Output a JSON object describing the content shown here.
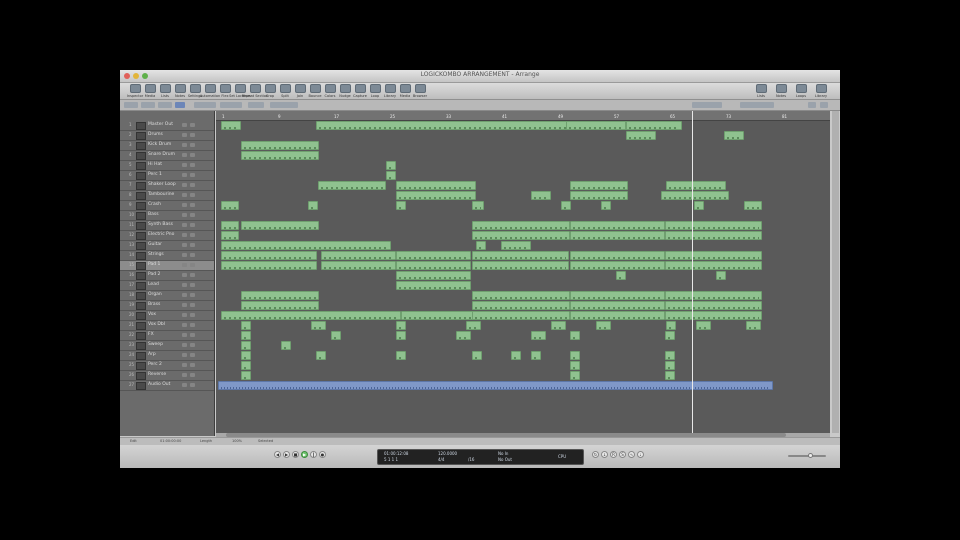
{
  "window": {
    "title": "LOGICKOMBO ARRANGEMENT - Arrange"
  },
  "toolbar": {
    "buttons": [
      "Inspector",
      "Media",
      "Lists",
      "Notes",
      "Settings",
      "Automation",
      "Flex",
      "Set Locators",
      "Repeat Section",
      "Crop",
      "Split",
      "Join",
      "Bounce",
      "Colors",
      "Nudge",
      "Capture",
      "Loop",
      "Library",
      "Media",
      "Browser"
    ],
    "right_buttons": [
      "Lists",
      "Notes",
      "Loops",
      "Library"
    ]
  },
  "subbar": {
    "edit": "Edit",
    "track": "Track",
    "region": "Region",
    "midi": "MIDI",
    "audio": "Audio",
    "view": "View",
    "snap": "Snap: Smart",
    "drag": "Drag: Overlap"
  },
  "tracks": [
    {
      "n": "1",
      "name": "Master Out"
    },
    {
      "n": "2",
      "name": "Drums"
    },
    {
      "n": "3",
      "name": "Kick Drum"
    },
    {
      "n": "4",
      "name": "Snare Drum"
    },
    {
      "n": "5",
      "name": "Hi Hat"
    },
    {
      "n": "6",
      "name": "Perc 1"
    },
    {
      "n": "7",
      "name": "Shaker Loop"
    },
    {
      "n": "8",
      "name": "Tambourine"
    },
    {
      "n": "9",
      "name": "Crash"
    },
    {
      "n": "10",
      "name": "Bass"
    },
    {
      "n": "11",
      "name": "Synth Bass"
    },
    {
      "n": "12",
      "name": "Electric Pno"
    },
    {
      "n": "13",
      "name": "Guitar"
    },
    {
      "n": "14",
      "name": "Strings"
    },
    {
      "n": "15",
      "name": "Pad 1"
    },
    {
      "n": "16",
      "name": "Pad 2"
    },
    {
      "n": "17",
      "name": "Lead"
    },
    {
      "n": "18",
      "name": "Organ"
    },
    {
      "n": "19",
      "name": "Brass"
    },
    {
      "n": "20",
      "name": "Vox"
    },
    {
      "n": "21",
      "name": "Vox Dbl"
    },
    {
      "n": "22",
      "name": "FX"
    },
    {
      "n": "23",
      "name": "Sweep"
    },
    {
      "n": "24",
      "name": "Arp"
    },
    {
      "n": "25",
      "name": "Perc 2"
    },
    {
      "n": "26",
      "name": "Reverse"
    },
    {
      "n": "27",
      "name": "Audio Out"
    }
  ],
  "ruler": {
    "ticks": [
      "1",
      "9",
      "17",
      "25",
      "33",
      "41",
      "49",
      "57",
      "65",
      "73",
      "81"
    ]
  },
  "status": {
    "left": "Edit",
    "pos": "01:00:00:00",
    "info": "Length",
    "zoom": "100%",
    "mode": "Selected"
  },
  "transport": {
    "buttons": [
      "rewind",
      "ffwd",
      "stop",
      "play",
      "pause",
      "record",
      "cycle",
      "autopunch",
      "replace",
      "solo",
      "sync",
      "metronome"
    ],
    "lcd": {
      "smpte": "01:00:12:08",
      "bars": "5 1 1 1",
      "tempo": "120.0000",
      "sig": "4/4",
      "div": "/16",
      "in": "No In",
      "out": "No Out",
      "cpu": "CPU"
    }
  },
  "colors": {
    "region": "#8fc28f",
    "region_border": "#6fa06f",
    "audio_region": "#7f98c8",
    "arrange_bg": "#5a5a5a",
    "tracklist_bg": "#6b6b6b"
  }
}
